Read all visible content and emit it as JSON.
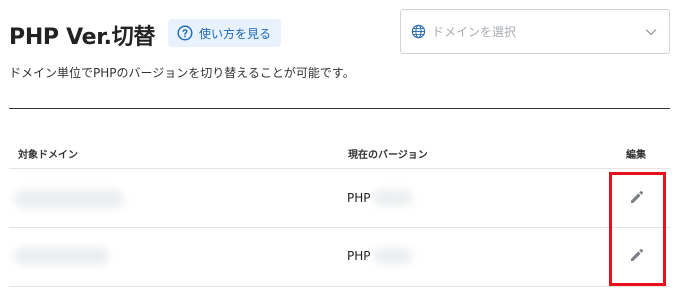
{
  "page": {
    "title": "PHP Ver.切替",
    "help_button": "使い方を見る",
    "description": "ドメイン単位でPHPのバージョンを切り替えることが可能です。"
  },
  "domain_select": {
    "placeholder": "ドメインを選択"
  },
  "table": {
    "headers": {
      "domain": "対象ドメイン",
      "version": "現在のバージョン",
      "edit": "編集"
    },
    "rows": [
      {
        "domain": "",
        "version_prefix": "PHP",
        "version": ""
      },
      {
        "domain": "",
        "version_prefix": "PHP",
        "version": ""
      }
    ]
  },
  "colors": {
    "accent": "#1a66b8",
    "help_bg": "#e8f2fc",
    "highlight": "#e8101a"
  },
  "icons": {
    "help": "question-circle-icon",
    "domain_select": "globe-icon",
    "dropdown": "chevron-down-icon",
    "edit": "pencil-icon"
  }
}
